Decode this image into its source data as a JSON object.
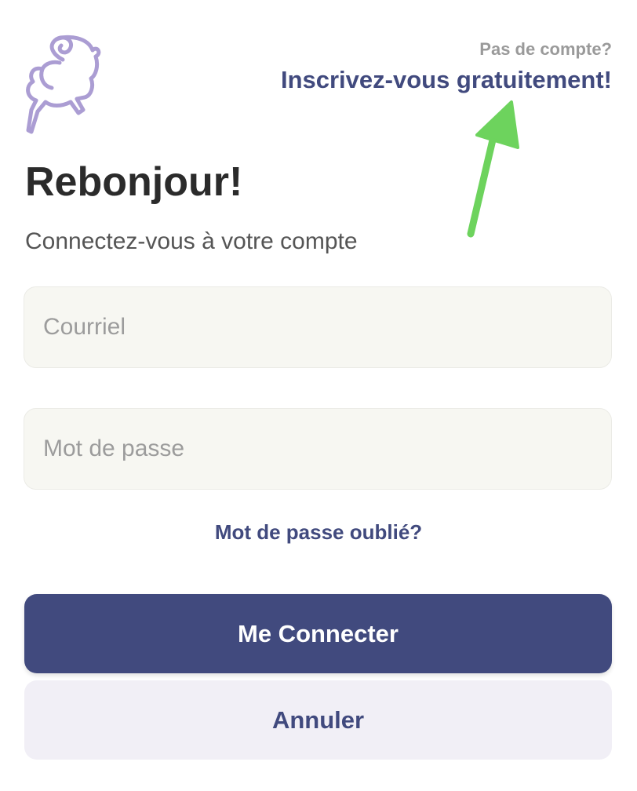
{
  "header": {
    "signup_prompt": "Pas de compte?",
    "signup_link": "Inscrivez-vous gratuitement!"
  },
  "main": {
    "title": "Rebonjour!",
    "subtitle": "Connectez-vous à votre compte"
  },
  "form": {
    "email_placeholder": "Courriel",
    "email_value": "",
    "password_placeholder": "Mot de passe",
    "password_value": "",
    "forgot_password": "Mot de passe oublié?"
  },
  "actions": {
    "login_label": "Me Connecter",
    "cancel_label": "Annuler"
  },
  "icons": {
    "logo": "ram-logo-icon",
    "annotation": "green-arrow-icon"
  },
  "colors": {
    "brand": "#414a7e",
    "logo": "#ab9dd3",
    "annotation": "#6dd35d",
    "field_bg": "#f7f7f2",
    "secondary_bg": "#f1eff6"
  }
}
